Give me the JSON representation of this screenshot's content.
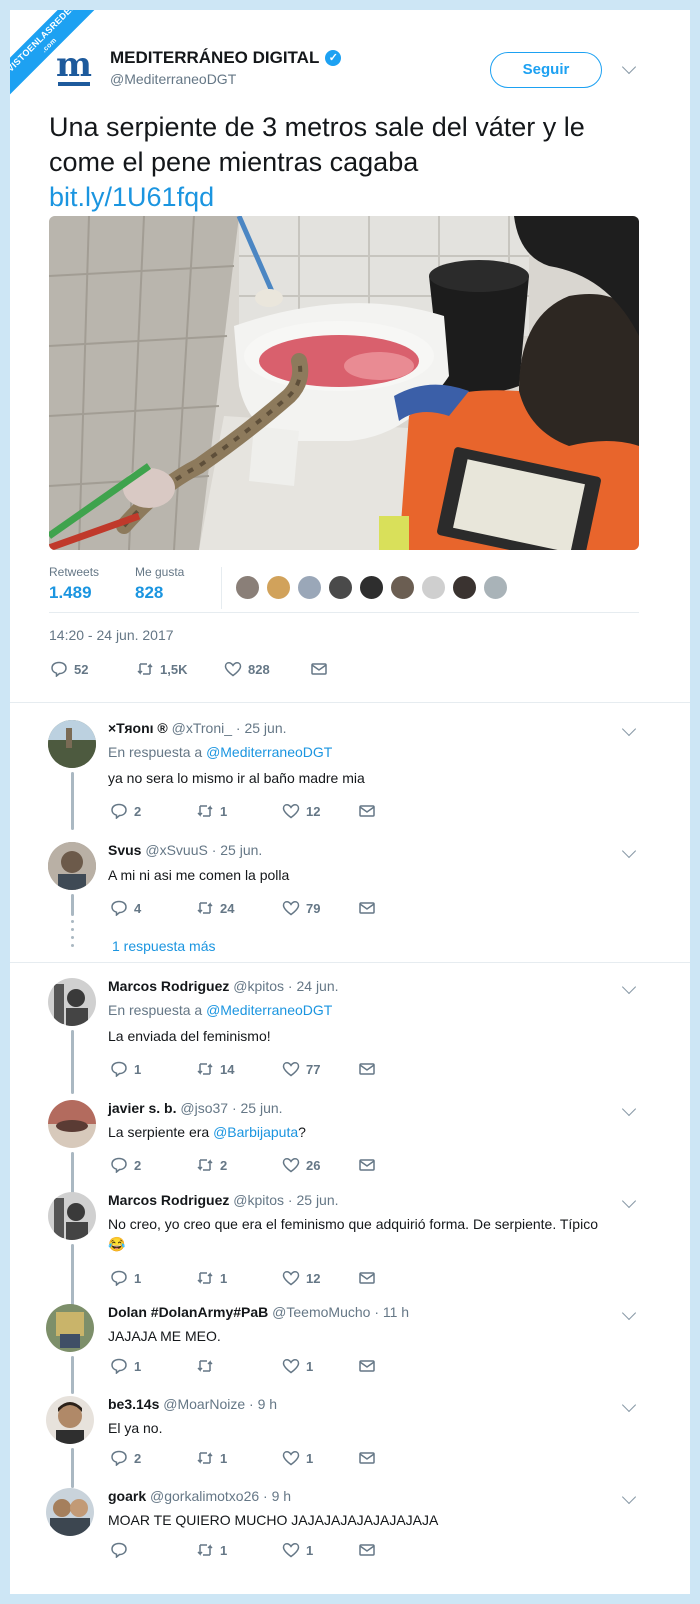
{
  "watermark": {
    "line1": "VISTOENLASREDES",
    "line2": ".com"
  },
  "tweet": {
    "author_name": "MEDITERRÁNEO DIGITAL",
    "author_handle": "@MediterraneoDGT",
    "logo_letter": "m",
    "follow_label": "Seguir",
    "text": "Una serpiente de 3 metros sale del váter y le come el pene mientras cagaba",
    "link": "bit.ly/1U61fqd",
    "retweets_label": "Retweets",
    "retweets_value": "1.489",
    "likes_label": "Me gusta",
    "likes_value": "828",
    "timestamp": "14:20 - 24 jun. 2017",
    "replies_count": "52",
    "retweet_count": "1,5K",
    "like_count": "828",
    "accent_color": "#1da1f2",
    "link_color": "#1b95e0"
  },
  "replies": [
    {
      "name": "×Тяоnı ®",
      "handle": "@xTroni_ · 25 jun.",
      "in_reply_label": "En respuesta a",
      "in_reply_to": "@MediterraneoDGT",
      "text": "ya no sera lo mismo ir al baño madre mia",
      "replies": "2",
      "retweets": "1",
      "likes": "12"
    },
    {
      "name": "Svus",
      "handle": "@xSvuuS · 25 jun.",
      "text": "A mi ni asi me comen la polla",
      "replies": "4",
      "retweets": "24",
      "likes": "79",
      "more": "1 respuesta más"
    },
    {
      "name": "Marcos Rodriguez",
      "handle": "@kpitos · 24 jun.",
      "in_reply_label": "En respuesta a",
      "in_reply_to": "@MediterraneoDGT",
      "text": "La enviada del feminismo!",
      "replies": "1",
      "retweets": "14",
      "likes": "77"
    },
    {
      "name": "javier s. b.",
      "handle": "@jso37 · 25 jun.",
      "text_before": "La serpiente era ",
      "mention": "@Barbijaputa",
      "text_after": "?",
      "replies": "2",
      "retweets": "2",
      "likes": "26"
    },
    {
      "name": "Marcos Rodriguez",
      "handle": "@kpitos · 25 jun.",
      "text": "No creo, yo creo que era el feminismo que adquirió forma. De serpiente. Típico",
      "emoji": "😂",
      "replies": "1",
      "retweets": "1",
      "likes": "12"
    },
    {
      "name": "Dolan #DolanArmy#PaB",
      "handle": "@TeemoMucho · 11 h",
      "text": "JAJAJA ME MEO.",
      "replies": "1",
      "retweets": "",
      "likes": "1"
    },
    {
      "name": "be3.14s",
      "handle": "@MoarNoize · 9 h",
      "text": "El ya no.",
      "replies": "2",
      "retweets": "1",
      "likes": "1"
    },
    {
      "name": "goark",
      "handle": "@gorkalimotxo26 · 9 h",
      "text": "MOAR TE QUIERO MUCHO JAJAJAJAJAJAJAJAJA",
      "replies": "",
      "retweets": "1",
      "likes": "1"
    }
  ]
}
